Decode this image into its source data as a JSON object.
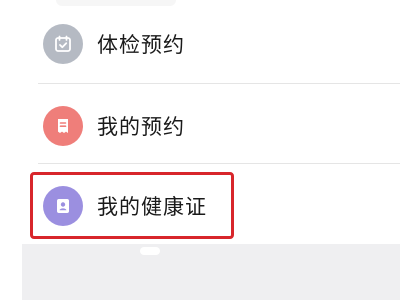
{
  "menu": {
    "items": [
      {
        "label": "体检预约",
        "icon": "calendar-check-icon",
        "icon_color": "#b5bac3"
      },
      {
        "label": "我的预约",
        "icon": "receipt-doc-icon",
        "icon_color": "#ef7e7a"
      },
      {
        "label": "我的健康证",
        "icon": "id-card-icon",
        "icon_color": "#9b8fe0"
      }
    ]
  },
  "colors": {
    "highlight_border": "#d8262b",
    "text": "#1a1a1a",
    "divider": "#e5e5e5",
    "bottom_panel": "#efeff1"
  }
}
